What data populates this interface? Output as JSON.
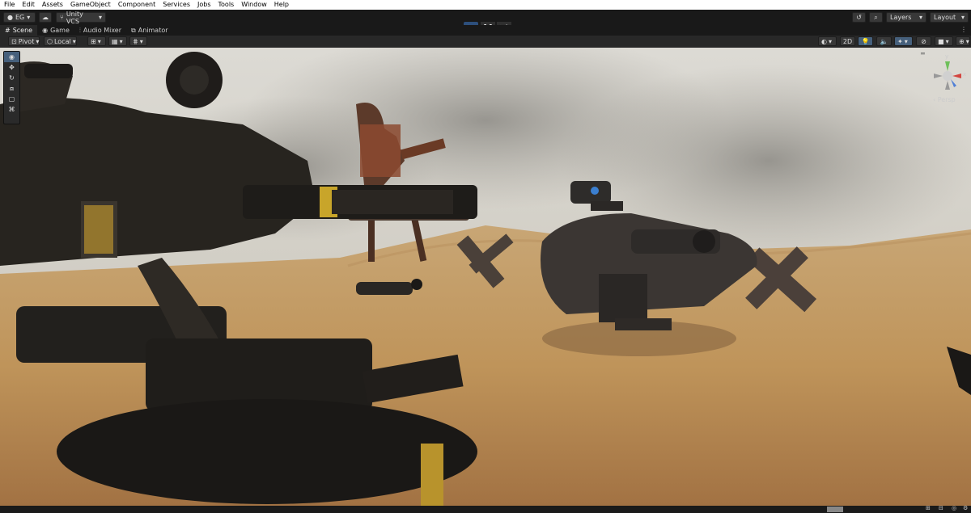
{
  "menu": [
    "File",
    "Edit",
    "Assets",
    "GameObject",
    "Component",
    "Services",
    "Jobs",
    "Tools",
    "Window",
    "Help"
  ],
  "toolbar": {
    "account": "EG",
    "vcs": "Unity VCS",
    "layers": "Layers",
    "layout": "Layout"
  },
  "tabs": [
    "Scene",
    "Game",
    "Audio Mixer",
    "Animator"
  ],
  "scene_toolbar": {
    "pivot": "Pivot",
    "local": "Local",
    "two_d": "2D"
  },
  "gizmo": {
    "view": "Persp",
    "y": "y",
    "x": "x"
  },
  "colors": {
    "accent": "#46607c",
    "play_active": "#2d4f7c",
    "sand": "#c6995f",
    "sky": "#cfccc4"
  }
}
